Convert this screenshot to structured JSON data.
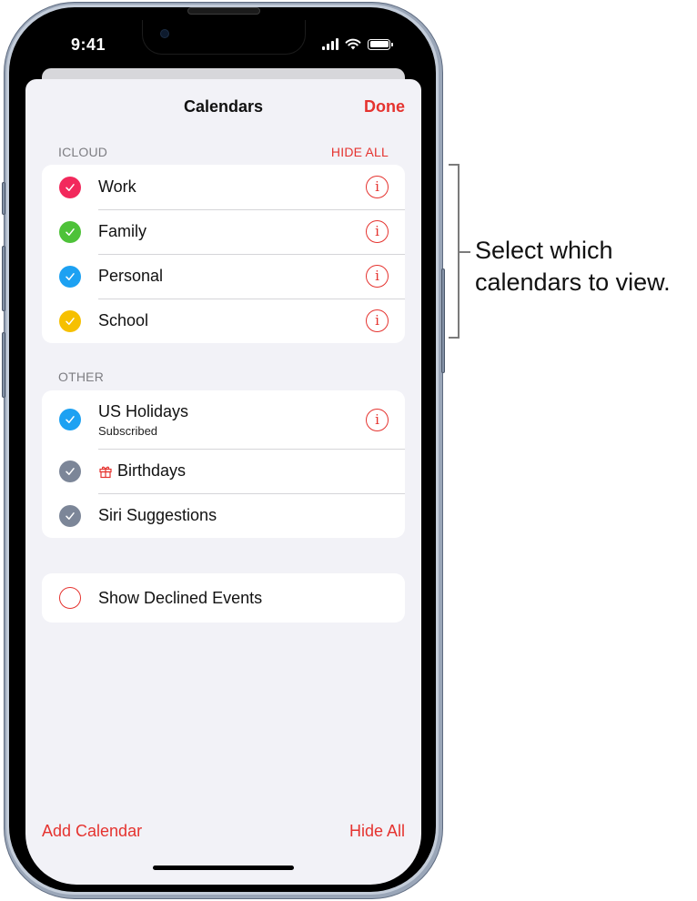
{
  "status_bar": {
    "time": "9:41",
    "icons": [
      "cellular-signal-icon",
      "wifi-icon",
      "battery-icon"
    ]
  },
  "nav": {
    "title": "Calendars",
    "done_label": "Done"
  },
  "sections": {
    "icloud": {
      "header": "ICLOUD",
      "action_label": "HIDE ALL",
      "items": [
        {
          "label": "Work",
          "checked": true,
          "color": "#f2295c",
          "info": true
        },
        {
          "label": "Family",
          "checked": true,
          "color": "#4ec239",
          "info": true
        },
        {
          "label": "Personal",
          "checked": true,
          "color": "#1da1f2",
          "info": true
        },
        {
          "label": "School",
          "checked": true,
          "color": "#f6c000",
          "info": true
        }
      ]
    },
    "other": {
      "header": "OTHER",
      "items": [
        {
          "label": "US Holidays",
          "subtitle": "Subscribed",
          "checked": true,
          "color": "#1da1f2",
          "info": true
        },
        {
          "label": "Birthdays",
          "icon": "gift-icon",
          "checked": true,
          "color": "#7c8698",
          "info": false
        },
        {
          "label": "Siri Suggestions",
          "checked": true,
          "color": "#7c8698",
          "info": false
        }
      ]
    },
    "declined": {
      "label": "Show Declined Events",
      "checked": false
    }
  },
  "footer": {
    "add_calendar_label": "Add Calendar",
    "hide_all_label": "Hide All"
  },
  "callout": {
    "text": "Select which calendars to view."
  },
  "colors": {
    "accent": "#e5332f",
    "sheet_background": "#f2f2f7"
  }
}
